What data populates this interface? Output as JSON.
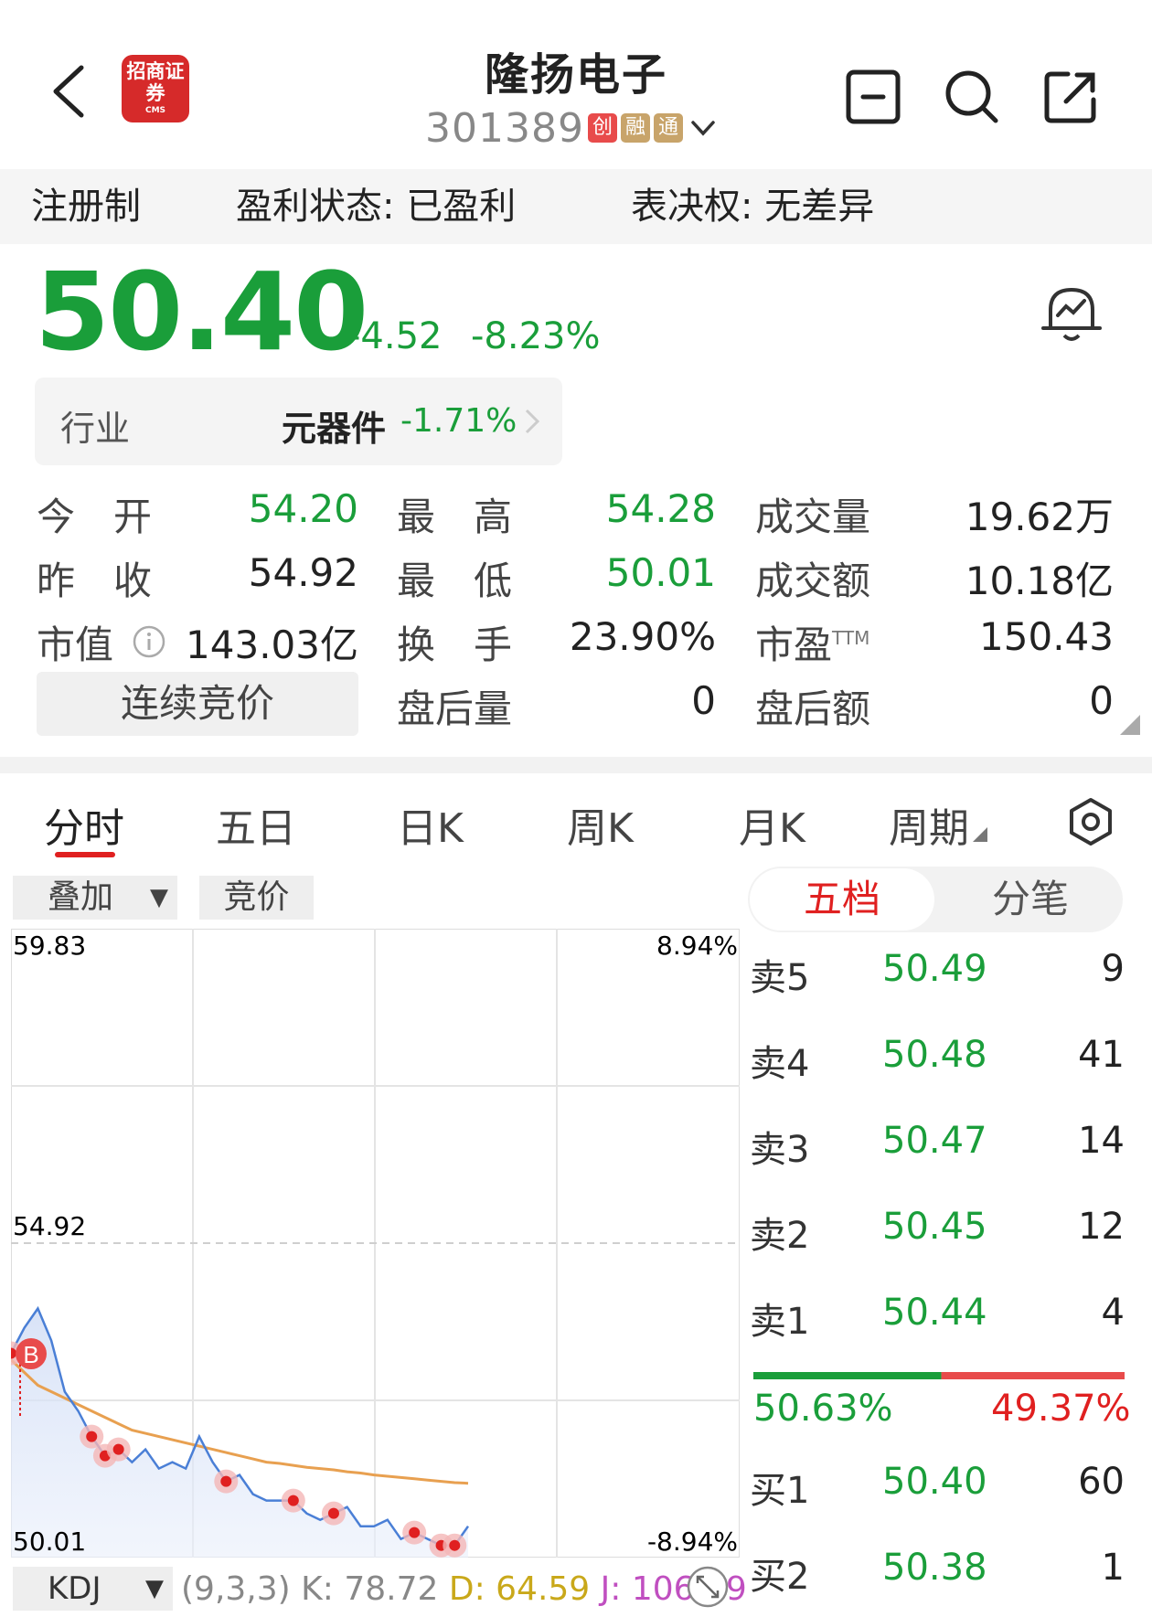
{
  "header": {
    "brand_logo_text": "招商证券",
    "brand_logo_sub": "CMS",
    "title": "隆扬电子",
    "code": "301389",
    "tags": [
      "创",
      "融",
      "通"
    ]
  },
  "info_strip": {
    "registration": "注册制",
    "profit_status": "盈利状态: 已盈利",
    "voting_rights": "表决权: 无差异"
  },
  "quote": {
    "price": "50.40",
    "change": "-4.52",
    "change_pct": "-8.23%"
  },
  "industry": {
    "label": "行业",
    "name": "元器件",
    "pct": "-1.71%"
  },
  "stats": [
    {
      "label": "今　开",
      "value": "54.20",
      "color": "green"
    },
    {
      "label": "最　高",
      "value": "54.28",
      "color": "green"
    },
    {
      "label": "成交量",
      "value": "19.62万",
      "color": "black"
    },
    {
      "label": "昨　收",
      "value": "54.92",
      "color": "black"
    },
    {
      "label": "最　低",
      "value": "50.01",
      "color": "green"
    },
    {
      "label": "成交额",
      "value": "10.18亿",
      "color": "black"
    },
    {
      "label": "市值",
      "value": "143.03亿",
      "color": "black"
    },
    {
      "label": "换　手",
      "value": "23.90%",
      "color": "black"
    },
    {
      "label": "市盈",
      "label_sup": "TTM",
      "value": "150.43",
      "color": "black"
    },
    {
      "label": "盘后量",
      "value": "0",
      "color": "black"
    },
    {
      "label": "盘后额",
      "value": "0",
      "color": "black"
    }
  ],
  "auction_label": "连续竞价",
  "tabs": [
    "分时",
    "五日",
    "日K",
    "周K",
    "月K",
    "周期"
  ],
  "chart_toolbar": {
    "overlay": "叠加",
    "auction": "竞价"
  },
  "chart_data": {
    "type": "line",
    "y_left_ticks": [
      "59.83",
      "54.92",
      "50.01"
    ],
    "y_right_ticks": [
      "8.94%",
      "-8.94%"
    ],
    "ylim": [
      50.01,
      59.83
    ],
    "prev_close": 54.92,
    "marker_label": "B",
    "price_series": [
      53.2,
      53.6,
      53.9,
      53.4,
      52.6,
      52.3,
      51.9,
      51.6,
      51.7,
      51.5,
      51.7,
      51.4,
      51.5,
      51.4,
      51.9,
      51.5,
      51.2,
      51.3,
      51.0,
      50.9,
      50.9,
      50.9,
      50.7,
      50.6,
      50.7,
      50.8,
      50.5,
      50.5,
      50.6,
      50.3,
      50.4,
      50.3,
      50.2,
      50.2,
      50.5
    ],
    "avg_series": [
      53.1,
      52.9,
      52.7,
      52.6,
      52.5,
      52.4,
      52.3,
      52.2,
      52.1,
      52.0,
      51.95,
      51.9,
      51.85,
      51.8,
      51.75,
      51.7,
      51.65,
      51.6,
      51.55,
      51.5,
      51.48,
      51.45,
      51.42,
      51.4,
      51.38,
      51.35,
      51.33,
      51.3,
      51.28,
      51.26,
      51.24,
      51.22,
      51.2,
      51.18,
      51.17
    ]
  },
  "kdj": {
    "name": "KDJ",
    "params": "(9,3,3)",
    "k": "K: 78.72",
    "d": "D: 64.59",
    "j": "J: 106.99"
  },
  "orderbook": {
    "tab_five": "五档",
    "tab_tick": "分笔",
    "asks": [
      {
        "label": "卖5",
        "price": "50.49",
        "vol": "9"
      },
      {
        "label": "卖4",
        "price": "50.48",
        "vol": "41"
      },
      {
        "label": "卖3",
        "price": "50.47",
        "vol": "14"
      },
      {
        "label": "卖2",
        "price": "50.45",
        "vol": "12"
      },
      {
        "label": "卖1",
        "price": "50.44",
        "vol": "4"
      }
    ],
    "ratio_buy": "50.63%",
    "ratio_sell": "49.37%",
    "ratio_buy_value": 50.63,
    "bids": [
      {
        "label": "买1",
        "price": "50.40",
        "vol": "60"
      },
      {
        "label": "买2",
        "price": "50.38",
        "vol": "1"
      }
    ]
  },
  "colors": {
    "up": "#e02020",
    "down": "#1a9e3a",
    "avg_line": "#e8a050",
    "price_line": "#4a7fd6"
  }
}
